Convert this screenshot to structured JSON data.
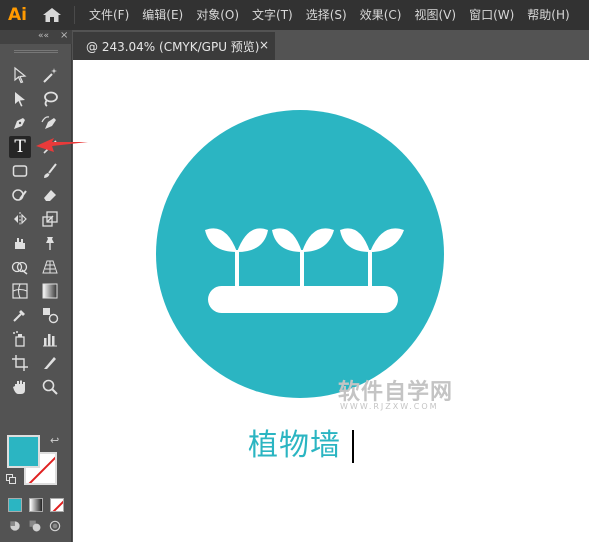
{
  "app": {
    "logo": "Ai",
    "home_icon": "home-icon"
  },
  "menu": {
    "items": [
      "文件(F)",
      "编辑(E)",
      "对象(O)",
      "文字(T)",
      "选择(S)",
      "效果(C)",
      "视图(V)",
      "窗口(W)",
      "帮助(H)"
    ]
  },
  "document_tab": {
    "title": "@ 243.04% (CMYK/GPU 预览)",
    "close_label": "×"
  },
  "toolbar": {
    "collapse_label": "««",
    "close_label": "×",
    "active_tool": "type-tool",
    "tools": [
      "selection-tool",
      "direct-selection-tool",
      "magic-wand-tool",
      "lasso-tool",
      "pen-tool",
      "curvature-tool",
      "type-tool",
      "line-tool",
      "rectangle-tool",
      "paintbrush-tool",
      "shaper-tool",
      "eraser-tool",
      "rotate-tool",
      "scale-tool",
      "warp-tool",
      "puppet-warp-tool",
      "shape-builder-tool",
      "perspective-grid-tool",
      "mesh-tool",
      "gradient-tool",
      "eyedropper-tool",
      "blend-tool",
      "symbol-sprayer-tool",
      "column-graph-tool",
      "artboard-tool",
      "slice-tool",
      "hand-tool",
      "zoom-tool"
    ],
    "type_tool_glyph": "T",
    "fill_color": "#2bb5c2",
    "stroke_color": "none"
  },
  "canvas": {
    "logo_circle_color": "#2bb5c2",
    "text_value": "植物墙",
    "text_color": "#2bb5c2",
    "watermark_main": "软件自学网",
    "watermark_sub": "WWW.RJZXW.COM"
  },
  "annotation": {
    "arrow_color": "#e83a3a"
  }
}
